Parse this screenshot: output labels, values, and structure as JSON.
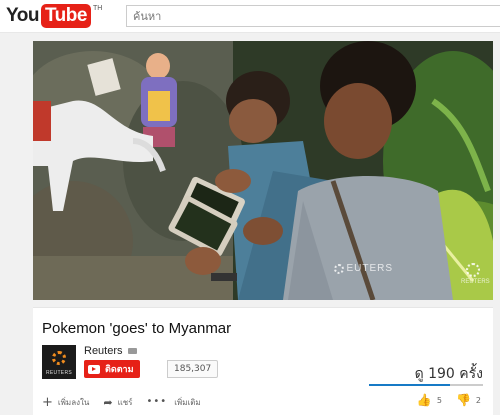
{
  "masthead": {
    "logo_you": "You",
    "logo_tube": "Tube",
    "logo_tm": "TH",
    "search_placeholder": "ค้นหา"
  },
  "player": {
    "watermark": "EUTERS",
    "watermark_small": "REUTERS"
  },
  "video": {
    "title": "Pokemon 'goes' to Myanmar",
    "channel_name": "Reuters",
    "channel_avatar_text": "REUTERS",
    "subscribe_label": "ติดตาม",
    "subscriber_count": "185,307",
    "views": "ดู 190 ครั้ง",
    "like_ratio": 0.71
  },
  "actions": {
    "add_label": "เพิ่มลงใน",
    "share_label": "แชร์",
    "more_label": "เพิ่มเติม",
    "like_count": "5",
    "dislike_count": "2"
  },
  "icons": [
    "youtube-logo",
    "plus-icon",
    "share-arrow-icon",
    "more-dots-icon",
    "thumbs-up-icon",
    "thumbs-down-icon",
    "verified-icon"
  ],
  "colors": {
    "brand_red": "#e62117",
    "like_blue": "#167ac6"
  }
}
